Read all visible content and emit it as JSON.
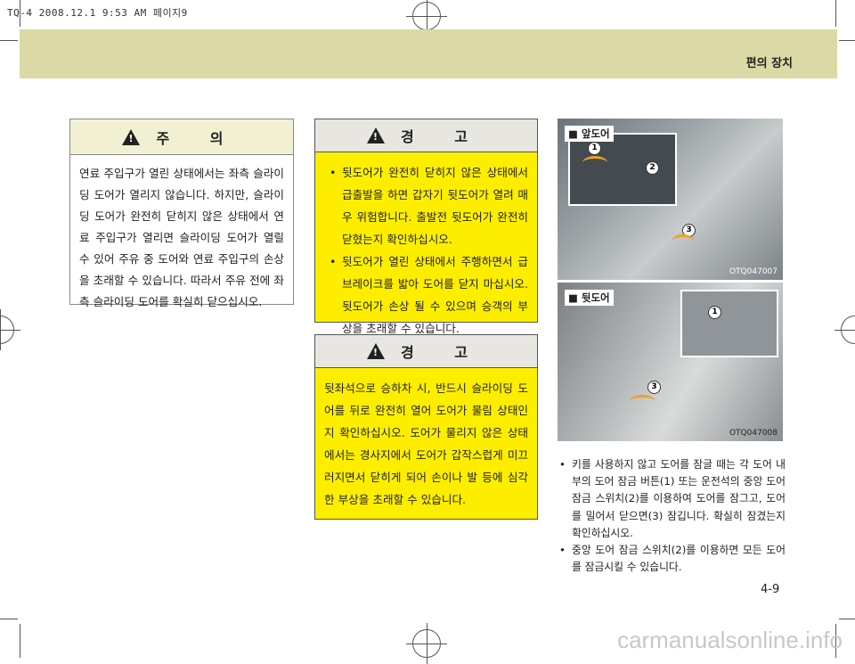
{
  "print_header": "TQ-4 2008.12.1 9:53 AM 페이지9",
  "section_title": "편의 장치",
  "caution": {
    "title": "주 의",
    "text": "연료 주입구가 열린 상태에서는 좌측 슬라이딩 도어가 열리지 않습니다. 하지만, 슬라이딩 도어가 완전히 닫히지 않은 상태에서 연료 주입구가 열리면 슬라이딩 도어가 열릴 수 있어 주유 중 도어와 연료 주입구의 손상을 초래할 수 있습니다. 따라서 주유 전에 좌측 슬라이딩 도어를 확실히 닫으십시오."
  },
  "warning1": {
    "title": "경 고",
    "items": [
      "뒷도어가 완전히 닫히지 않은 상태에서 급출발을 하면 갑자기 뒷도어가 열려 매우 위험합니다. 출발전 뒷도어가 완전히 닫혔는지 확인하십시오.",
      "뒷도어가 열린 상태에서 주행하면서 급브레이크를 밟아 도어를 닫지 마십시오. 뒷도어가 손상 될 수 있으며 승객의 부상을 초래할 수 있습니다."
    ]
  },
  "warning2": {
    "title": "경 고",
    "text": "뒷좌석으로 승하차 시, 반드시 슬라이딩 도어를 뒤로 완전히 열어 도어가 물림 상태인지 확인하십시오. 도어가 물리지 않은 상태에서는 경사지에서 도어가 갑작스럽게 미끄러지면서 닫히게 되어 손이나 발 등에 심각한 부상을 초래할 수 있습니다."
  },
  "figures": [
    {
      "label": "■ 앞도어",
      "code": "OTQ047007",
      "callouts": [
        "1",
        "2",
        "3"
      ]
    },
    {
      "label": "■ 뒷도어",
      "code": "OTQ047008",
      "callouts": [
        "1",
        "3"
      ]
    }
  ],
  "bullets": [
    "키를 사용하지 않고 도어를 잠글 때는 각 도어 내부의 도어 잠금 버튼(1) 또는 운전석의 중앙 도어 잠금 스위치(2)를 이용하여 도어를 잠그고, 도어를 밀어서 닫으면(3) 잠깁니다. 확실히 잠겼는지 확인하십시오.",
    "중앙 도어 잠금 스위치(2)를 이용하면 모든 도어를 잠금시킬 수 있습니다."
  ],
  "page_number": "4-9",
  "watermark": "carmanualsonline.info"
}
